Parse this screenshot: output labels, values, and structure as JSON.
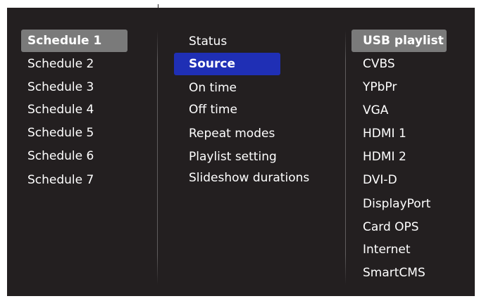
{
  "schedules": {
    "items": [
      {
        "label": "Schedule 1",
        "selected": true
      },
      {
        "label": "Schedule 2"
      },
      {
        "label": "Schedule 3"
      },
      {
        "label": "Schedule 4"
      },
      {
        "label": "Schedule 5"
      },
      {
        "label": "Schedule 6"
      },
      {
        "label": "Schedule 7"
      }
    ]
  },
  "settings": {
    "items": [
      {
        "label": "Status"
      },
      {
        "label": "Source",
        "focused": true
      },
      {
        "label": "On time"
      },
      {
        "label": "Off time"
      },
      {
        "label": "Repeat modes"
      },
      {
        "label": "Playlist setting"
      },
      {
        "label": "Slideshow durations"
      }
    ]
  },
  "sources": {
    "items": [
      {
        "label": "USB playlist",
        "selected": true
      },
      {
        "label": "CVBS"
      },
      {
        "label": "YPbPr"
      },
      {
        "label": "VGA"
      },
      {
        "label": "HDMI 1"
      },
      {
        "label": "HDMI 2"
      },
      {
        "label": "DVI-D"
      },
      {
        "label": "DisplayPort"
      },
      {
        "label": "Card OPS"
      },
      {
        "label": "Internet"
      },
      {
        "label": "SmartCMS"
      }
    ]
  },
  "colors": {
    "background": "#231f20",
    "selected_grey": "#7a7a7a",
    "focused_blue": "#1f2fb5",
    "text": "#ffffff"
  }
}
